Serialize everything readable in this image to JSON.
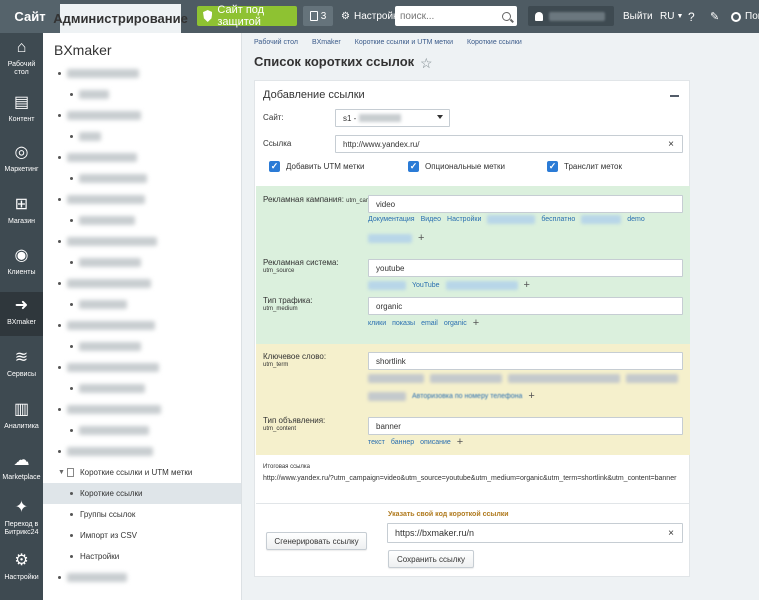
{
  "topbar": {
    "site": "Сайт",
    "admin": "Администрирование",
    "protect": "Сайт под защитой",
    "notif_count": "3",
    "settings": "Настройки",
    "search_placeholder": "поиск...",
    "logout": "Выйти",
    "lang": "RU",
    "help": "?",
    "more": "Пом"
  },
  "leftmenu": [
    {
      "label": "Рабочий стол",
      "icon": "home-icon"
    },
    {
      "label": "Контент",
      "icon": "content-icon"
    },
    {
      "label": "Маркетинг",
      "icon": "target-icon"
    },
    {
      "label": "Магазин",
      "icon": "cart-icon"
    },
    {
      "label": "Клиенты",
      "icon": "clients-icon"
    },
    {
      "label": "BXmaker",
      "icon": "bxmaker-arrow-icon"
    },
    {
      "label": "Сервисы",
      "icon": "layers-icon"
    },
    {
      "label": "Аналитика",
      "icon": "chart-icon"
    },
    {
      "label": "Marketplace",
      "icon": "cloud-icon"
    },
    {
      "label": "Переход в Битрикс24",
      "icon": "bitrix24-icon"
    },
    {
      "label": "Настройки",
      "icon": "gear-icon"
    }
  ],
  "tree": {
    "title": "BXmaker",
    "section": "Короткие ссылки и UTM метки",
    "items": [
      "Короткие ссылки",
      "Группы ссылок",
      "Импорт из CSV",
      "Настройки"
    ]
  },
  "breadcrumb": [
    "Рабочий стол",
    "BXmaker",
    "Короткие ссылки и UTM метки",
    "Короткие ссылки"
  ],
  "page_title": "Список коротких ссылок",
  "card": {
    "title": "Добавление ссылки",
    "site_label": "Сайт:",
    "site_value": "s1 -",
    "link_label": "Ссылка",
    "link_value": "http://www.yandex.ru/",
    "checkboxes": [
      "Добавить UTM метки",
      "Опциональные метки",
      "Транслит меток"
    ],
    "utm_campaign": {
      "label": "Рекламная кампания:",
      "sub": "utm_campaign",
      "value": "video",
      "tags": [
        "Документация",
        "Видео",
        "Настройки",
        "бесплатно",
        "demo"
      ]
    },
    "utm_source": {
      "label": "Рекламная система:",
      "sub": "utm_source",
      "value": "youtube",
      "tags": [
        "YouTube"
      ]
    },
    "utm_medium": {
      "label": "Тип трафика:",
      "sub": "utm_medium",
      "value": "organic",
      "tags": [
        "клики",
        "показы",
        "email",
        "organic"
      ]
    },
    "utm_term": {
      "label": "Ключевое слово:",
      "sub": "utm_term",
      "value": "shortlink",
      "tags": [
        "Авторизовка по номеру телефона"
      ]
    },
    "utm_content": {
      "label": "Тип объявления:",
      "sub": "utm_content",
      "value": "banner",
      "tags": [
        "текст",
        "баннер",
        "описание"
      ]
    },
    "result_label": "Итоговая ссылка",
    "result_url": "http://www.yandex.ru/?utm_campaign=video&utm_source=youtube&utm_medium=organic&utm_term=shortlink&utm_content=banner",
    "generate_button": "Сгенерировать ссылку",
    "code_label": "Указать свой код короткой ссылки",
    "code_value": "https://bxmaker.ru/n",
    "save_button": "Сохранить ссылку"
  }
}
